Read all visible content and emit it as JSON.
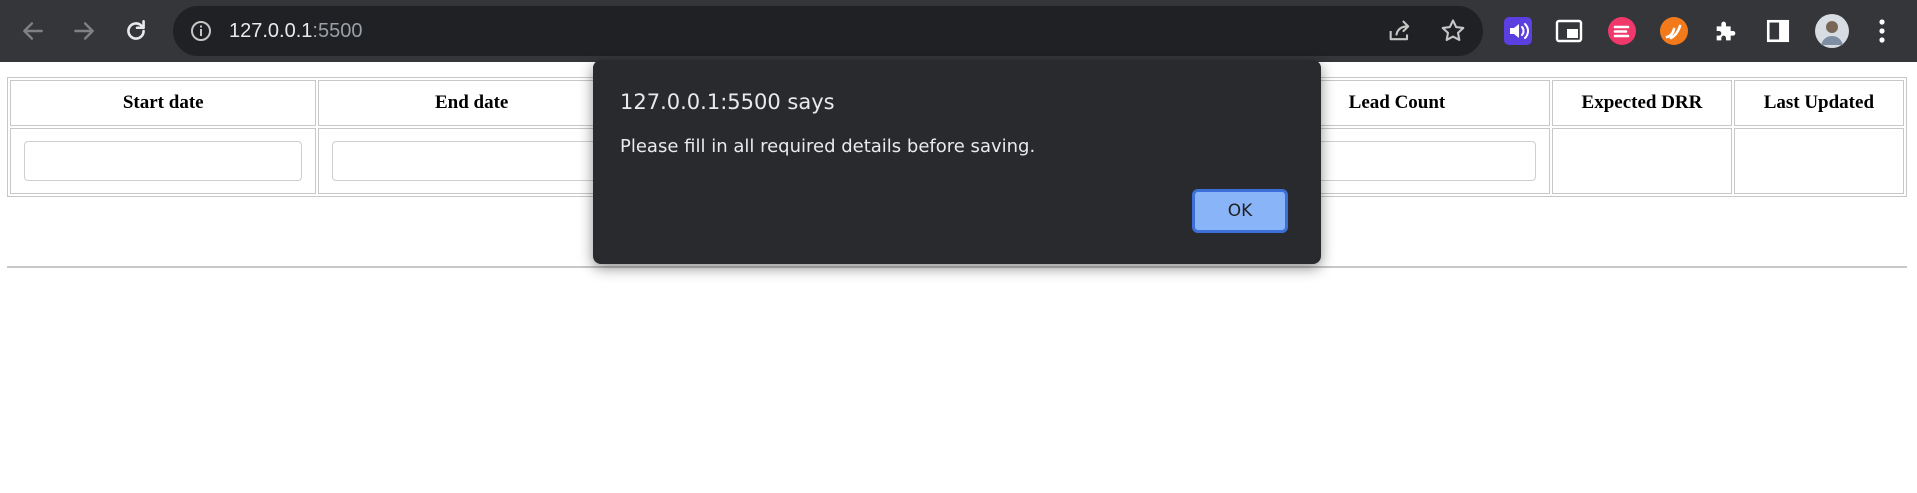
{
  "browser": {
    "url_host": "127.0.0.1",
    "url_port": ":5500",
    "icons": {
      "back": "arrow-left-icon",
      "forward": "arrow-right-icon",
      "reload": "reload-icon",
      "site_info": "info-icon",
      "share": "share-icon",
      "bookmark": "star-icon",
      "extensions": [
        "read-aloud-extension-icon",
        "picture-in-picture-icon",
        "pink-extension-icon",
        "orange-extension-icon",
        "puzzle-icon",
        "side-panel-icon",
        "avatar",
        "kebab-menu-icon"
      ]
    }
  },
  "table": {
    "headers": [
      "Start date",
      "End date",
      "",
      "",
      "Lead Count",
      "Expected DRR",
      "Last Updated"
    ]
  },
  "dialog": {
    "title": "127.0.0.1:5500 says",
    "message": "Please fill in all required details before saving.",
    "ok_label": "OK"
  },
  "colors": {
    "chrome_bg": "#35363a",
    "omnibox_bg": "#202124",
    "dialog_bg": "#292a2d",
    "ok_button": "#8ab4f8"
  }
}
